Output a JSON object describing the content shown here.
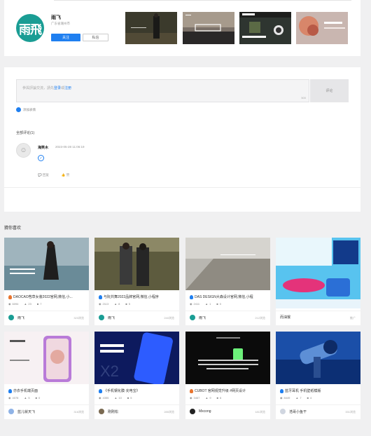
{
  "profile": {
    "avatar_text": "雨飛",
    "name": "雨飞",
    "role": "广东省潮州市",
    "follow_label": "关注",
    "message_label": "私信"
  },
  "comments": {
    "placeholder_prefix": "參與評論交流，請先",
    "login_label": "登录",
    "or_label": "或",
    "register_label": "注册",
    "char_count": "500",
    "submit_label": "评论",
    "emoji_label": "添加表情",
    "all_comments_label": "全部评论(1)",
    "items": [
      {
        "user": "海笑木",
        "time": "2023-05-28 11:06:19",
        "reply_label": "回复",
        "like_label": "赞"
      }
    ]
  },
  "recommend": {
    "title": "猜你喜欢",
    "items": [
      {
        "title": "DAOCAO苞草女装2022官网,微信,小...",
        "views": "6094",
        "likes": "23",
        "comments": "7",
        "author": "雨飞",
        "view_count": "323浏览"
      },
      {
        "title": "与阮共舞2022品牌官网,微信,小程序",
        "views": "2113",
        "likes": "8",
        "comments": "5",
        "author": "雨飞",
        "view_count": "240浏览"
      },
      {
        "title": "DAS DESIGN大森设计官网,微信,小程",
        "views": "2411",
        "likes": "1",
        "comments": "0",
        "author": "雨飞",
        "view_count": "212浏览"
      },
      {
        "title": "",
        "views": "",
        "likes": "",
        "comments": "",
        "author": "而油猴",
        "view_count": "推广"
      },
      {
        "title": "亦衣手机端页面",
        "views": "4078",
        "likes": "5",
        "comments": "0",
        "author": "蓝儿就天飞",
        "view_count": "316浏览"
      },
      {
        "title": "《手机钢化膜·充电宝》",
        "views": "4355",
        "likes": "10",
        "comments": "5",
        "author": "刚刚松",
        "view_count": "285浏览"
      },
      {
        "title": "CUBOT 官网视觉升级 #网页设计",
        "views": "3467",
        "likes": "9",
        "comments": "6",
        "author": "Mxcong",
        "view_count": "181浏览"
      },
      {
        "title": "蓝牙耳机 手机壁纸模版",
        "views": "8449",
        "likes": "7",
        "comments": "4",
        "author": "浩哥小鱼干",
        "view_count": "331浏览"
      }
    ]
  },
  "colors": {
    "accent": "#1f7ff0",
    "brand": "#1a9d94"
  }
}
